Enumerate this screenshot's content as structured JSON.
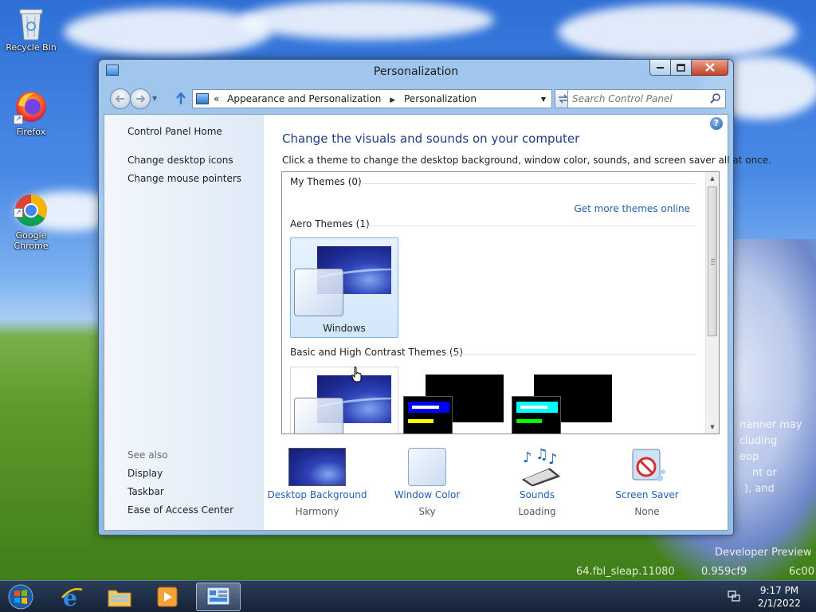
{
  "desktop": {
    "icons": [
      {
        "label": "Recycle Bin"
      },
      {
        "label": "Firefox"
      },
      {
        "label": "Google\nChrome"
      }
    ],
    "watermark_lines": [
      "Developer Preview",
      "64.fbl_sleap.11080",
      "0.959cf9",
      "6c00"
    ],
    "license_fragments": [
      "nanner may",
      "cluding",
      "eop",
      "nt or",
      "), and"
    ]
  },
  "window": {
    "title": "Personalization",
    "address": {
      "chevron": "«",
      "crumbs": [
        "Appearance and Personalization",
        "Personalization"
      ]
    },
    "search_placeholder": "Search Control Panel",
    "left_nav": {
      "home": "Control Panel Home",
      "links": [
        "Change desktop icons",
        "Change mouse pointers"
      ],
      "see_also_heading": "See also",
      "see_also": [
        "Display",
        "Taskbar",
        "Ease of Access Center"
      ]
    },
    "heading": "Change the visuals and sounds on your computer",
    "subheading": "Click a theme to change the desktop background, window color, sounds, and screen saver all at once.",
    "themes": {
      "my_themes": "My Themes (0)",
      "get_more": "Get more themes online",
      "aero_heading": "Aero Themes (1)",
      "aero_items": [
        "Windows"
      ],
      "basic_heading": "Basic and High Contrast Themes (5)"
    },
    "bottom_bar": [
      {
        "label": "Desktop Background",
        "value": "Harmony"
      },
      {
        "label": "Window Color",
        "value": "Sky"
      },
      {
        "label": "Sounds",
        "value": "Loading"
      },
      {
        "label": "Screen Saver",
        "value": "None"
      }
    ]
  },
  "taskbar": {
    "time": "9:17 PM",
    "date": "2/1/2022"
  },
  "colors": {
    "link": "#1f5fb6",
    "heading": "#1e3d82",
    "close_button": "#c6422a"
  }
}
